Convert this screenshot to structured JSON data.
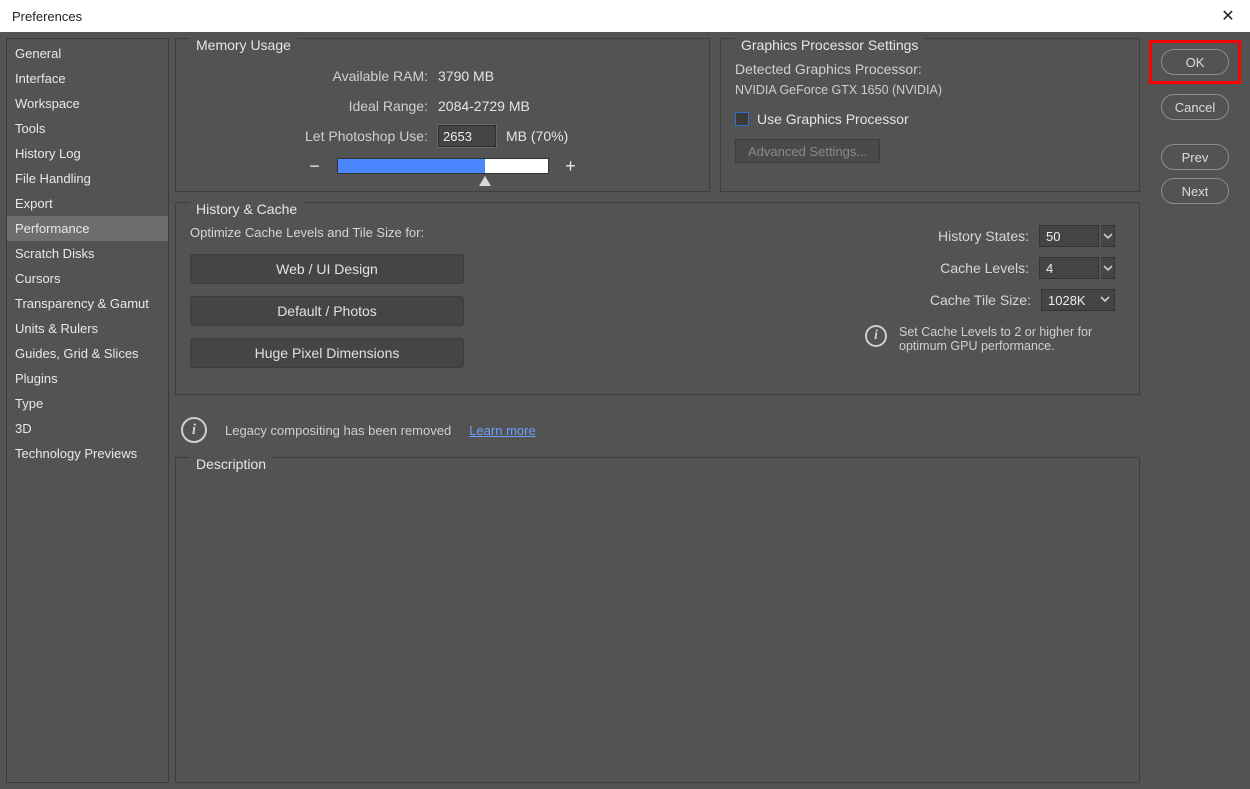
{
  "window": {
    "title": "Preferences"
  },
  "sidebar": {
    "items": [
      {
        "label": "General"
      },
      {
        "label": "Interface"
      },
      {
        "label": "Workspace"
      },
      {
        "label": "Tools"
      },
      {
        "label": "History Log"
      },
      {
        "label": "File Handling"
      },
      {
        "label": "Export"
      },
      {
        "label": "Performance"
      },
      {
        "label": "Scratch Disks"
      },
      {
        "label": "Cursors"
      },
      {
        "label": "Transparency & Gamut"
      },
      {
        "label": "Units & Rulers"
      },
      {
        "label": "Guides, Grid & Slices"
      },
      {
        "label": "Plugins"
      },
      {
        "label": "Type"
      },
      {
        "label": "3D"
      },
      {
        "label": "Technology Previews"
      }
    ],
    "active_index": 7
  },
  "buttons": {
    "ok": "OK",
    "cancel": "Cancel",
    "prev": "Prev",
    "next": "Next"
  },
  "memory": {
    "title": "Memory Usage",
    "available_label": "Available RAM:",
    "available_value": "3790 MB",
    "ideal_label": "Ideal Range:",
    "ideal_value": "2084-2729 MB",
    "use_label": "Let Photoshop Use:",
    "use_value": "2653",
    "use_suffix": "MB (70%)",
    "minus": "−",
    "plus": "+",
    "slider_percent": 70
  },
  "gpu": {
    "title": "Graphics Processor Settings",
    "detected_label": "Detected Graphics Processor:",
    "detected_value": "NVIDIA GeForce GTX 1650 (NVIDIA)",
    "use_gpu_label": "Use Graphics Processor",
    "use_gpu_checked": false,
    "advanced_label": "Advanced Settings..."
  },
  "history_cache": {
    "title": "History & Cache",
    "optimize_label": "Optimize Cache Levels and Tile Size for:",
    "btn_web": "Web / UI Design",
    "btn_default": "Default / Photos",
    "btn_huge": "Huge Pixel Dimensions",
    "history_states_label": "History States:",
    "history_states_value": "50",
    "cache_levels_label": "Cache Levels:",
    "cache_levels_value": "4",
    "cache_tile_label": "Cache Tile Size:",
    "cache_tile_value": "1028K",
    "info_text": "Set Cache Levels to 2 or higher for optimum GPU performance."
  },
  "legacy": {
    "text": "Legacy compositing has been removed",
    "link": "Learn more"
  },
  "description": {
    "title": "Description"
  }
}
